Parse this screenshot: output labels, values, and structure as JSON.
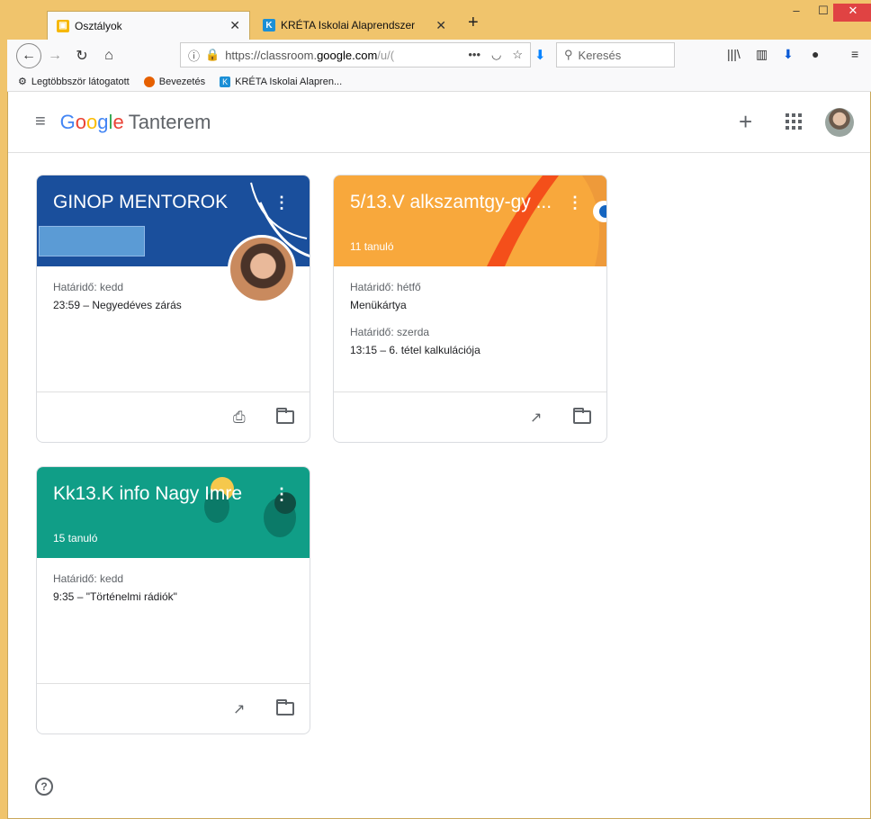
{
  "browser": {
    "tabs": [
      {
        "title": "Osztályok",
        "active": true
      },
      {
        "title": "KRÉTA Iskolai Alaprendszer",
        "active": false
      }
    ],
    "url": {
      "prefix": "https://classroom.",
      "host": "google.com",
      "suffix": "/u/("
    },
    "search_placeholder": "Keresés",
    "bookmarks": [
      {
        "label": "Legtöbbször látogatott"
      },
      {
        "label": "Bevezetés"
      },
      {
        "label": "KRÉTA Iskolai Alapren..."
      }
    ]
  },
  "app": {
    "logo_letters": [
      "G",
      "o",
      "o",
      "g",
      "l",
      "e"
    ],
    "product": "Tanterem"
  },
  "classes": [
    {
      "title": "GINOP MENTOROK",
      "subtitle": "",
      "color": "#1a4f9c",
      "due": [
        {
          "label": "Határidő: kedd",
          "item": "23:59 – Negyedéves zárás"
        }
      ]
    },
    {
      "title": "5/13.V alkszamtgy-gy ...",
      "subtitle": "11 tanuló",
      "color": "#f8a83c",
      "due": [
        {
          "label": "Határidő: hétfő",
          "item": "Menükártya"
        },
        {
          "label": "Határidő: szerda",
          "item": "13:15 – 6. tétel kalkulációja"
        }
      ]
    },
    {
      "title": "Kk13.K info Nagy Imre",
      "subtitle": "15 tanuló",
      "color": "#109e87",
      "due": [
        {
          "label": "Határidő: kedd",
          "item": "9:35 – \"Történelmi rádiók\""
        }
      ]
    }
  ]
}
